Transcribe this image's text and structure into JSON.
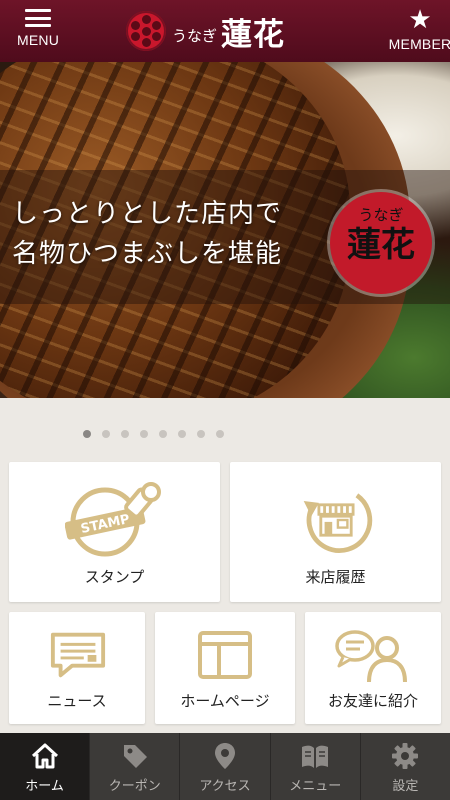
{
  "header": {
    "menu_label": "MENU",
    "member_label": "MEMBER",
    "logo_small": "うなぎ",
    "logo_big": "蓮花"
  },
  "hero": {
    "line1": "しっとりとした店内で",
    "line2": "名物ひつまぶしを堪能",
    "badge_small": "うなぎ",
    "badge_big": "蓮花"
  },
  "carousel": {
    "count": 8,
    "active": 1
  },
  "tiles": {
    "stamp": "スタンプ",
    "stamp_icon_text": "STAMP",
    "visits": "来店履歴",
    "news": "ニュース",
    "homepage": "ホームページ",
    "invite": "お友達に紹介"
  },
  "tabs": [
    {
      "label": "ホーム",
      "icon": "home-icon"
    },
    {
      "label": "クーポン",
      "icon": "coupon-tag-icon"
    },
    {
      "label": "アクセス",
      "icon": "location-pin-icon"
    },
    {
      "label": "メニュー",
      "icon": "book-icon"
    },
    {
      "label": "設定",
      "icon": "gear-icon"
    }
  ],
  "colors": {
    "header": "#5e0f22",
    "icon_gold": "#d6be86",
    "tabbar": "#3c3a38",
    "tab_active": "#1e1c1b",
    "background": "#ece9e4"
  }
}
